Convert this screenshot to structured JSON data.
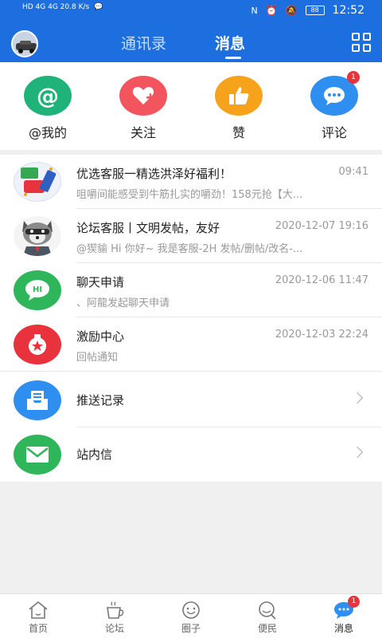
{
  "status_bar": {
    "left_text": "HD 4G 4G 20.8 K/s",
    "time": "12:52",
    "battery": "88"
  },
  "header": {
    "tabs": [
      {
        "label": "通讯录",
        "active": false
      },
      {
        "label": "消息",
        "active": true
      }
    ]
  },
  "quick_actions": [
    {
      "label": "@我的",
      "color": "#1fb37a",
      "icon": "at-icon"
    },
    {
      "label": "关注",
      "color": "#f2555d",
      "icon": "heart-plus-icon"
    },
    {
      "label": "赞",
      "color": "#f7a21b",
      "icon": "thumbs-up-icon"
    },
    {
      "label": "评论",
      "color": "#2f8ff0",
      "icon": "chat-bubble-icon",
      "badge": "1"
    }
  ],
  "messages": [
    {
      "title": "优选客服一精选洪泽好福利！",
      "time": "09:41",
      "subtitle": "咀嚼间能感受到牛筋扎实的嚼劲！158元抢【大..."
    },
    {
      "title": "论坛客服丨文明发帖，友好",
      "time": "2020-12-07 19:16",
      "subtitle": "@猰貐 Hi 你好~ 我是客服-2H 发帖/删帖/改名-..."
    },
    {
      "title": "聊天申请",
      "time": "2020-12-06 11:47",
      "subtitle": "、阿龍发起聊天申请"
    },
    {
      "title": "激励中心",
      "time": "2020-12-03 22:24",
      "subtitle": "回帖通知"
    }
  ],
  "links": [
    {
      "label": "推送记录"
    },
    {
      "label": "站内信"
    }
  ],
  "bottom_nav": [
    {
      "label": "首页",
      "icon": "home-icon"
    },
    {
      "label": "论坛",
      "icon": "coffee-cup-icon"
    },
    {
      "label": "圈子",
      "icon": "smile-icon"
    },
    {
      "label": "便民",
      "icon": "search-icon"
    },
    {
      "label": "消息",
      "icon": "message-icon",
      "badge": "1",
      "active": true
    }
  ],
  "colors": {
    "brand_blue": "#1d6fe0",
    "badge_red": "#e8323c"
  }
}
